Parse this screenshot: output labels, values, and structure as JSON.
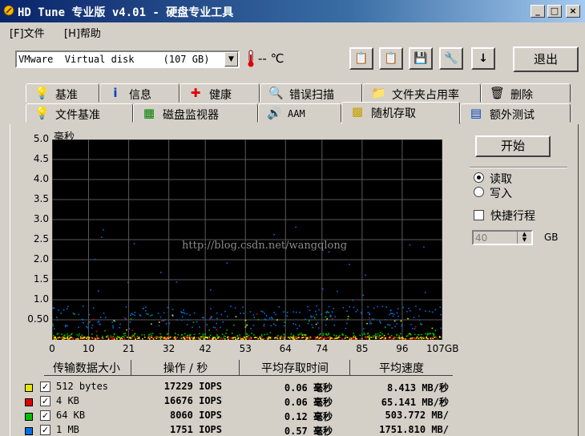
{
  "window": {
    "title": "HD Tune 专业版 v4.01 - 硬盘专业工具"
  },
  "menu": {
    "file": "[F]文件",
    "help": "[H]帮助"
  },
  "toolbar": {
    "disk": "VMware  Virtual disk     (107 GB)",
    "temperature": "-- ℃",
    "exit_label": "退出"
  },
  "tabs_row1": [
    {
      "label": "基准",
      "icon": "bulb-icon"
    },
    {
      "label": "信息",
      "icon": "info-icon"
    },
    {
      "label": "健康",
      "icon": "health-cross-icon"
    },
    {
      "label": "错误扫描",
      "icon": "magnifier-icon"
    },
    {
      "label": "文件夹占用率",
      "icon": "folder-icon"
    },
    {
      "label": "删除",
      "icon": "trash-icon"
    }
  ],
  "tabs_row2": [
    {
      "label": "文件基准",
      "icon": "file-benchmark-icon"
    },
    {
      "label": "磁盘监视器",
      "icon": "disk-monitor-icon"
    },
    {
      "label": "AAM",
      "icon": "speaker-icon"
    },
    {
      "label": "随机存取",
      "icon": "random-access-icon",
      "active": true
    },
    {
      "label": "额外测试",
      "icon": "extra-tests-icon"
    }
  ],
  "controls": {
    "start_label": "开始",
    "read_label": "读取",
    "write_label": "写入",
    "quick_label": "快捷行程",
    "size_value": "40",
    "size_unit": "GB",
    "mode_selected": "read",
    "quick_checked": false
  },
  "chart_data": {
    "type": "scatter",
    "ylabel": "毫秒",
    "y_ticks": [
      "5.0",
      "4.5",
      "4.0",
      "3.5",
      "3.0",
      "2.5",
      "2.0",
      "1.5",
      "1.0",
      "0.50"
    ],
    "x_ticks": [
      "0",
      "10",
      "21",
      "32",
      "42",
      "53",
      "64",
      "74",
      "85",
      "96",
      "107GB"
    ],
    "xlim": [
      0,
      107
    ],
    "ylim": [
      0,
      5.0
    ],
    "grid": true,
    "watermark": "http://blog.csdn.net/wangqlong",
    "series": [
      {
        "name": "512 bytes",
        "color": "#e6e600",
        "mean_ms": 0.06
      },
      {
        "name": "4 KB",
        "color": "#e00000",
        "mean_ms": 0.06
      },
      {
        "name": "64 KB",
        "color": "#00c000",
        "mean_ms": 0.12
      },
      {
        "name": "1 MB",
        "color": "#0070e0",
        "mean_ms": 0.57
      }
    ]
  },
  "table": {
    "headers": [
      "传输数据大小",
      "操作 / 秒",
      "平均存取时间",
      "平均速度"
    ],
    "rows": [
      {
        "size": "512 bytes",
        "iops": "17229 IOPS",
        "access": "0.06 毫秒",
        "speed": "8.413 MB/秒",
        "color": "#e6e600",
        "checked": true
      },
      {
        "size": "4 KB",
        "iops": "16676 IOPS",
        "access": "0.06 毫秒",
        "speed": "65.141 MB/秒",
        "color": "#e00000",
        "checked": true
      },
      {
        "size": "64 KB",
        "iops": "8060 IOPS",
        "access": "0.12 毫秒",
        "speed": "503.772 MB/",
        "color": "#00c000",
        "checked": true
      },
      {
        "size": "1 MB",
        "iops": "1751 IOPS",
        "access": "0.57 毫秒",
        "speed": "1751.810 MB/",
        "color": "#0070e0",
        "checked": true
      }
    ]
  }
}
